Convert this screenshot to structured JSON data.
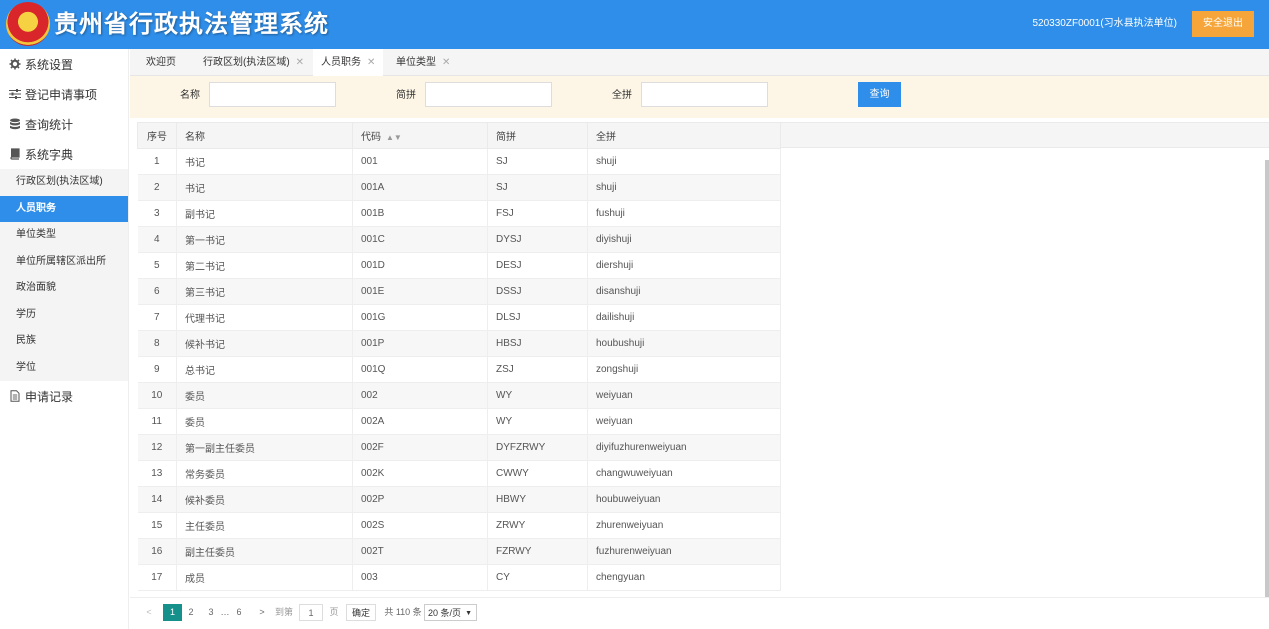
{
  "header": {
    "title": "贵州省行政执法管理系统",
    "user": "520330ZF0001(习水县执法单位)",
    "logout_label": "安全退出"
  },
  "sidebar": {
    "items": [
      {
        "label": "系统设置",
        "icon": "gear-icon"
      },
      {
        "label": "登记申请事项",
        "icon": "sliders-icon"
      },
      {
        "label": "查询统计",
        "icon": "database-icon"
      },
      {
        "label": "系统字典",
        "icon": "book-icon"
      }
    ],
    "submenu": [
      "行政区划(执法区域)",
      "人员职务",
      "单位类型",
      "单位所属辖区派出所",
      "政治面貌",
      "学历",
      "民族",
      "学位"
    ],
    "last_item": {
      "label": "申请记录",
      "icon": "document-icon"
    }
  },
  "tabs": [
    {
      "label": "欢迎页"
    },
    {
      "label": "行政区划(执法区域)"
    },
    {
      "label": "人员职务"
    },
    {
      "label": "单位类型"
    }
  ],
  "search": {
    "name_label": "名称",
    "abbr_label": "简拼",
    "full_label": "全拼",
    "query_label": "查询"
  },
  "table": {
    "columns": [
      "序号",
      "名称",
      "代码",
      "简拼",
      "全拼"
    ],
    "rows": [
      [
        "1",
        "书记",
        "001",
        "SJ",
        "shuji"
      ],
      [
        "2",
        "书记",
        "001A",
        "SJ",
        "shuji"
      ],
      [
        "3",
        "副书记",
        "001B",
        "FSJ",
        "fushuji"
      ],
      [
        "4",
        "第一书记",
        "001C",
        "DYSJ",
        "diyishuji"
      ],
      [
        "5",
        "第二书记",
        "001D",
        "DESJ",
        "diershuji"
      ],
      [
        "6",
        "第三书记",
        "001E",
        "DSSJ",
        "disanshuji"
      ],
      [
        "7",
        "代理书记",
        "001G",
        "DLSJ",
        "dailishuji"
      ],
      [
        "8",
        "候补书记",
        "001P",
        "HBSJ",
        "houbushuji"
      ],
      [
        "9",
        "总书记",
        "001Q",
        "ZSJ",
        "zongshuji"
      ],
      [
        "10",
        "委员",
        "002",
        "WY",
        "weiyuan"
      ],
      [
        "11",
        "委员",
        "002A",
        "WY",
        "weiyuan"
      ],
      [
        "12",
        "第一副主任委员",
        "002F",
        "DYFZRWY",
        "diyifuzhurenweiyuan"
      ],
      [
        "13",
        "常务委员",
        "002K",
        "CWWY",
        "changwuweiyuan"
      ],
      [
        "14",
        "候补委员",
        "002P",
        "HBWY",
        "houbuweiyuan"
      ],
      [
        "15",
        "主任委员",
        "002S",
        "ZRWY",
        "zhurenweiyuan"
      ],
      [
        "16",
        "副主任委员",
        "002T",
        "FZRWY",
        "fuzhurenweiyuan"
      ],
      [
        "17",
        "成员",
        "003",
        "CY",
        "chengyuan"
      ]
    ]
  },
  "pager": {
    "pages": [
      "1",
      "2",
      "3",
      "…",
      "6"
    ],
    "goto_label": "到第",
    "page_value": "1",
    "page_unit": "页",
    "confirm_label": "确定",
    "total": "共 110 条",
    "page_size": "20 条/页"
  }
}
